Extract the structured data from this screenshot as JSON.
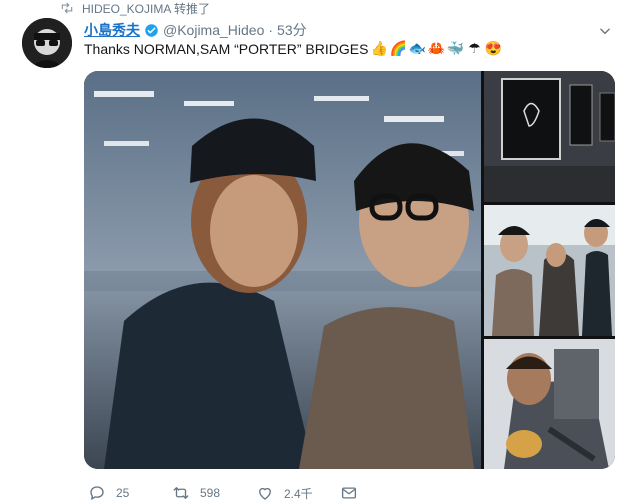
{
  "retweet_context": {
    "icon": "retweet-icon",
    "text": "HIDEO_KOJIMA 转推了"
  },
  "tweet": {
    "display_name": "小島秀夫",
    "verified": true,
    "handle": "@Kojima_Hideo",
    "separator": "·",
    "time": "53分",
    "text": "Thanks NORMAN,SAM  “PORTER” BRIDGES",
    "emojis": [
      "👍",
      "🌈",
      "🐟",
      "🦀",
      "🐳",
      "☂",
      "😍"
    ]
  },
  "media": {
    "main_photo": "Norman Reedus and Hideo Kojima photo",
    "thumbs": [
      "Death Stranding framed art gallery",
      "Kojima with Sam Porter figure",
      "Sam Porter figure close-up"
    ]
  },
  "actions": {
    "reply_count": "25",
    "retweet_count": "598",
    "like_count": "2.4千",
    "icons": [
      "reply-icon",
      "retweet-icon",
      "like-icon",
      "dm-icon"
    ]
  },
  "colors": {
    "link_blue": "#1a73c8",
    "muted": "#657786",
    "verified": "#1da1f2"
  }
}
